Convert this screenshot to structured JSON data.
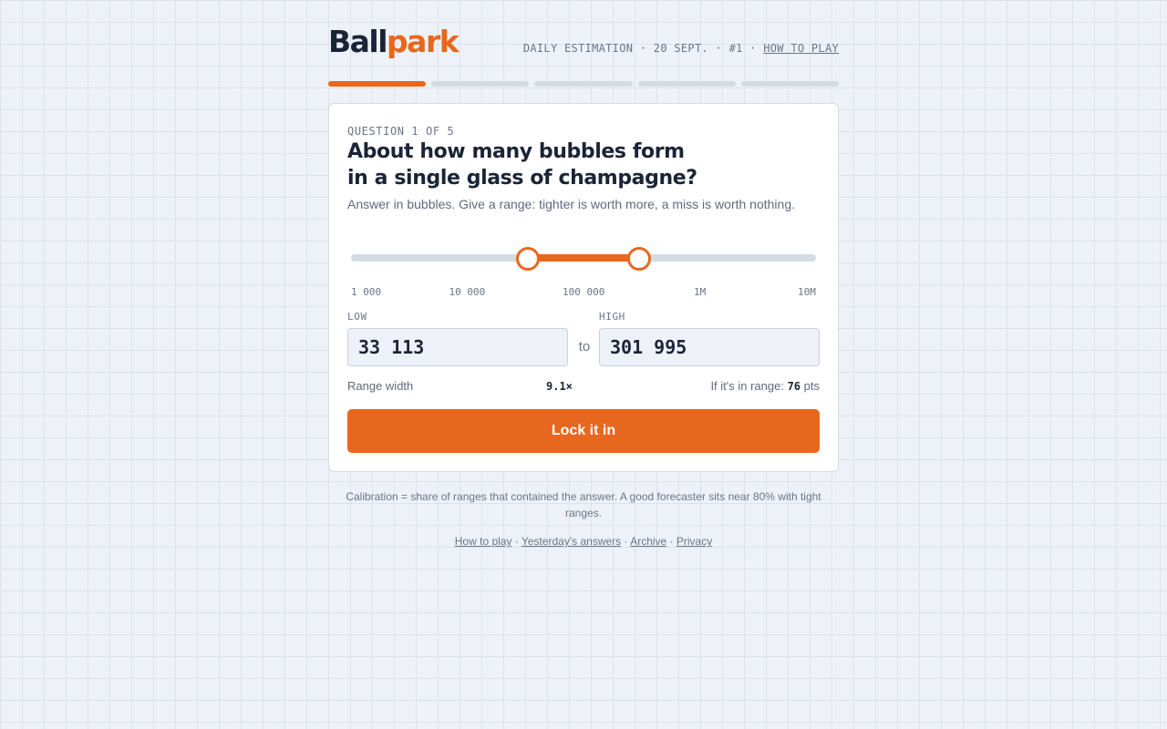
{
  "header": {
    "logo_part1": "Ball",
    "logo_part2": "park",
    "meta_text": "DAILY ESTIMATION · 20 SEPT. · #1 · ",
    "how_to_play_link": "HOW TO PLAY",
    "accent_color": "#e8671f"
  },
  "progress": {
    "current_question": 1,
    "total_questions": 5
  },
  "question": {
    "number_label": "QUESTION 1 OF 5",
    "title_line1": "About how many bubbles form",
    "title_line2": "in a single glass of champagne?",
    "subtitle": "Answer in bubbles. Give a range: tighter is worth more, a miss is worth nothing."
  },
  "slider": {
    "scale": "log",
    "min": 1000,
    "max": 10000000,
    "low": 33113,
    "high": 301995,
    "ticks": [
      "1 000",
      "10 000",
      "100 000",
      "1M",
      "10M"
    ]
  },
  "inputs": {
    "low_label": "LOW",
    "high_label": "HIGH",
    "low_value": "33 113",
    "high_value": "301 995",
    "separator": "to"
  },
  "stats": {
    "range_width_label": "Range width",
    "range_width_value": "9.1×",
    "points_prefix": "If it's in range: ",
    "points_value": "76",
    "points_suffix": " pts"
  },
  "cta_label": "Lock it in",
  "footer": {
    "note": "Calibration = share of ranges that contained the answer. A good forecaster sits near 80% with tight ranges.",
    "links": [
      "How to play",
      "Yesterday's answers",
      "Archive",
      "Privacy"
    ],
    "link_separator": " · "
  }
}
